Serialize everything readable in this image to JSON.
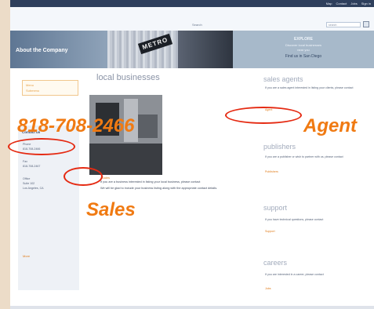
{
  "topnav": {
    "links": [
      "Map",
      "Contact",
      "Jobs",
      "Sign in"
    ]
  },
  "search": {
    "label": "Search",
    "placeholder": "search"
  },
  "banner": {
    "title": "About the Company",
    "photo_sign": "METRO",
    "caption_lines": [
      "EXPLORE",
      "Discover local businesses",
      "near you",
      "Find us in San Diego"
    ]
  },
  "sidebar": {
    "menu_items": [
      "Menu",
      "Submenu"
    ],
    "contact": {
      "title": "Contact us",
      "lines": [
        "Phone",
        "818-708-2466",
        "Fax",
        "818-708-2467",
        "Office",
        "Suite 102",
        "Los Angeles, CA"
      ],
      "more": "More"
    }
  },
  "main": {
    "title": "local businesses",
    "text1": "If you are a business interested in listing your local business, please contact",
    "link1": "Sales",
    "text2": "We will be glad to include your business listing along with the appropriate contact details."
  },
  "right": {
    "sections": [
      {
        "title": "sales agents",
        "text": "If you are a sales agent interested in listing your clients, please contact",
        "link": "Agent"
      },
      {
        "title": "publishers",
        "text": "If you are a publisher or wish to partner with us, please contact",
        "link": "Publishers"
      },
      {
        "title": "support",
        "text": "If you have technical questions, please contact",
        "link": "Support"
      },
      {
        "title": "careers",
        "text": "If you are interested in a career, please contact",
        "link": "Jobs"
      }
    ]
  },
  "annotations": {
    "phone": "818-708-2466",
    "agent": "Agent",
    "sales": "Sales",
    "color": "#f07a12",
    "circle_color": "#e52a12"
  }
}
